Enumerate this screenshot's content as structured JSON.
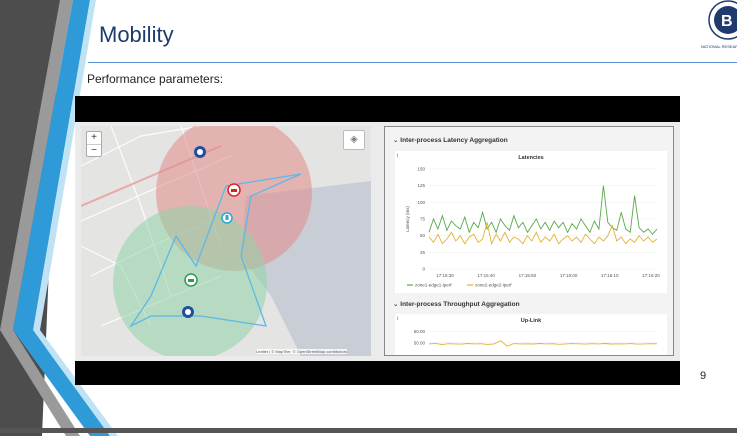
{
  "slide": {
    "title": "Mobility",
    "subtitle": "Performance parameters:",
    "page_number": "9",
    "logo_caption": "NATIONAL RESEARCH UNIVERSITY"
  },
  "map": {
    "zoom_in": "+",
    "zoom_out": "−",
    "attribution": "Leaflet | © MapTiler, © OpenStreetMap contributors",
    "zone_colors": {
      "red_zone": "#e28a8a",
      "green_zone": "#8fd4a8"
    }
  },
  "latency_panel": {
    "section_title": "Inter-process Latency Aggregation",
    "chart_title": "Latencies",
    "info": "i"
  },
  "throughput_panel": {
    "section_title": "Inter-process Throughput Aggregation",
    "chart_title": "Up-Link",
    "info": "i"
  },
  "chart_data": [
    {
      "type": "line",
      "title": "Latencies",
      "ylabel": "Latency (ms)",
      "xlabel": "",
      "ylim": [
        0,
        150
      ],
      "yticks": [
        0,
        25,
        50,
        75,
        100,
        125,
        150
      ],
      "xticks": [
        "17:15:30",
        "17:15:40",
        "17:15:50",
        "17:16:00",
        "17:16:10",
        "17:16:20"
      ],
      "legend_position": "bottom-left",
      "series": [
        {
          "name": "zone1-edge1-iperf",
          "color": "#5aa84a",
          "values": [
            55,
            75,
            60,
            80,
            58,
            72,
            65,
            60,
            78,
            55,
            70,
            62,
            85,
            60,
            70,
            55,
            75,
            65,
            58,
            80,
            62,
            70,
            55,
            65,
            75,
            60,
            70,
            58,
            72,
            62,
            70,
            55,
            68,
            60,
            75,
            65,
            55,
            72,
            60,
            125,
            70,
            62,
            58,
            85,
            60,
            55,
            110,
            62,
            55,
            60,
            52,
            60
          ]
        },
        {
          "name": "zone2-edge2-iperf",
          "color": "#e3b22e",
          "values": [
            48,
            40,
            52,
            38,
            45,
            55,
            42,
            50,
            38,
            48,
            52,
            40,
            45,
            70,
            38,
            52,
            42,
            55,
            40,
            48,
            45,
            38,
            50,
            42,
            55,
            40,
            48,
            42,
            52,
            38,
            45,
            50,
            42,
            48,
            40,
            52,
            45,
            38,
            48,
            42,
            50,
            65,
            42,
            48,
            38,
            45,
            40,
            50,
            42,
            48,
            40,
            45
          ]
        }
      ]
    },
    {
      "type": "line",
      "title": "Up-Link",
      "ylim": [
        40,
        65
      ],
      "yticks": [
        "60.00",
        "50.00"
      ],
      "series": [
        {
          "name": "",
          "color": "#e3b22e",
          "values": [
            49,
            49.5,
            48.5,
            49.2,
            49,
            48.8,
            49.4,
            49,
            49.2,
            48.6,
            49,
            52,
            47,
            49.3,
            49,
            49.1,
            48.9,
            49.4,
            49,
            49.2,
            48.7,
            49,
            49.3,
            49.1,
            48.8,
            49.2,
            49,
            49.4,
            48.9,
            49.1,
            49,
            49.3,
            48.8,
            49,
            49.2,
            49.1
          ]
        }
      ]
    }
  ]
}
